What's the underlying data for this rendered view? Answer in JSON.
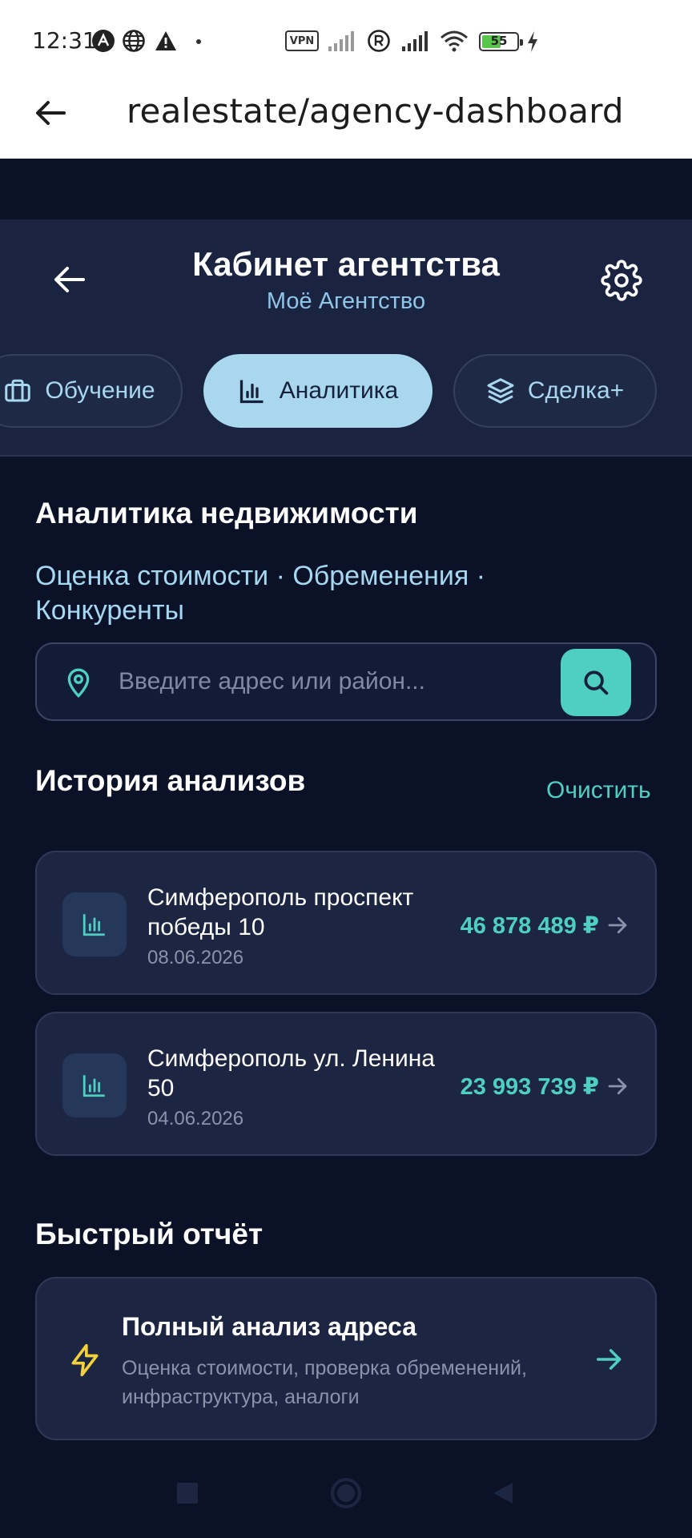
{
  "status_bar": {
    "time": "12:31",
    "vpn_label": "VPN",
    "battery_level": "55",
    "icons": [
      "notification-a-icon",
      "globe-icon",
      "warning-icon",
      "dot-icon",
      "signal-icon",
      "registered-icon",
      "signal-icon",
      "wifi-icon",
      "battery-icon",
      "charging-icon"
    ]
  },
  "browser": {
    "url": "realestate/agency-dashboard"
  },
  "header": {
    "title": "Кабинет агентства",
    "subtitle": "Моё Агентство"
  },
  "tabs": [
    {
      "label": "Обучение",
      "icon": "briefcase-icon",
      "active": false
    },
    {
      "label": "Аналитика",
      "icon": "bar-chart-icon",
      "active": true
    },
    {
      "label": "Сделка+",
      "icon": "layers-icon",
      "active": false
    }
  ],
  "analytics": {
    "title": "Аналитика недвижимости",
    "tagline": "Оценка стоимости · Обременения · Конкуренты",
    "search_placeholder": "Введите адрес или район..."
  },
  "history": {
    "title": "История анализов",
    "clear_label": "Очистить",
    "items": [
      {
        "address": "Симферополь проспект победы 10",
        "date": "08.06.2026",
        "price": "46 878 489 ₽"
      },
      {
        "address": "Симферополь ул. Ленина 50",
        "date": "04.06.2026",
        "price": "23 993 739 ₽"
      }
    ]
  },
  "quick_report": {
    "title": "Быстрый отчёт",
    "card_title": "Полный анализ адреса",
    "card_description": "Оценка стоимости, проверка обременений, инфраструктура, аналоги"
  },
  "colors": {
    "background": "#0b1228",
    "panel": "#1a2440",
    "accent": "#4fcfc2",
    "active_tab": "#a9d7ee",
    "bolt": "#f2d13a"
  }
}
